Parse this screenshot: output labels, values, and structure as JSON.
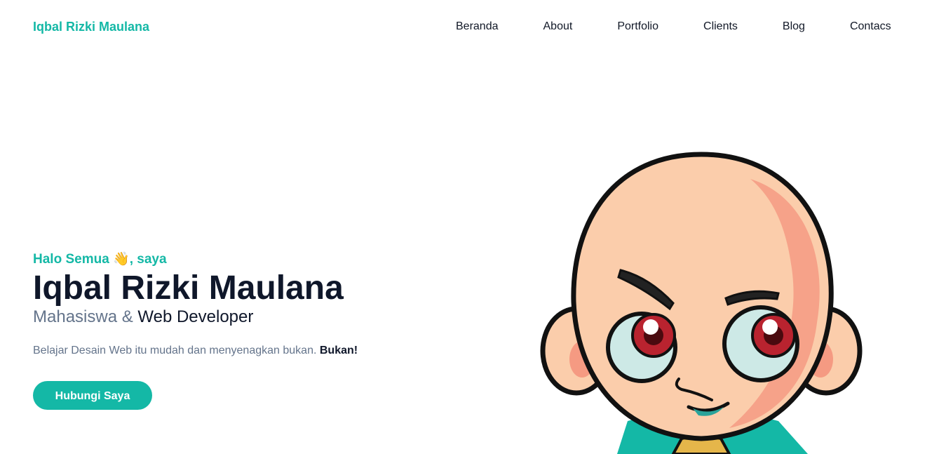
{
  "header": {
    "brand": "Iqbal Rizki Maulana",
    "nav": [
      {
        "label": "Beranda"
      },
      {
        "label": "About"
      },
      {
        "label": "Portfolio"
      },
      {
        "label": "Clients"
      },
      {
        "label": "Blog"
      },
      {
        "label": "Contacs"
      }
    ]
  },
  "hero": {
    "greeting_prefix": "Halo Semua ",
    "greeting_emoji": "👋",
    "greeting_suffix": ", saya",
    "name": "Iqbal Rizki Maulana",
    "role_part1": "Mahasiswa & ",
    "role_part2": "Web Developer",
    "tagline": "Belajar Desain Web itu mudah dan menyenagkan bukan. ",
    "tagline_bold": "Bukan!",
    "cta_label": "Hubungi Saya",
    "illustration_icon": "cartoon-bald-boy-icon"
  },
  "colors": {
    "accent": "#14b8a6",
    "heading": "#0f172a",
    "muted": "#64748b",
    "skin": "#fbcdab",
    "cheek": "#f59a82"
  }
}
